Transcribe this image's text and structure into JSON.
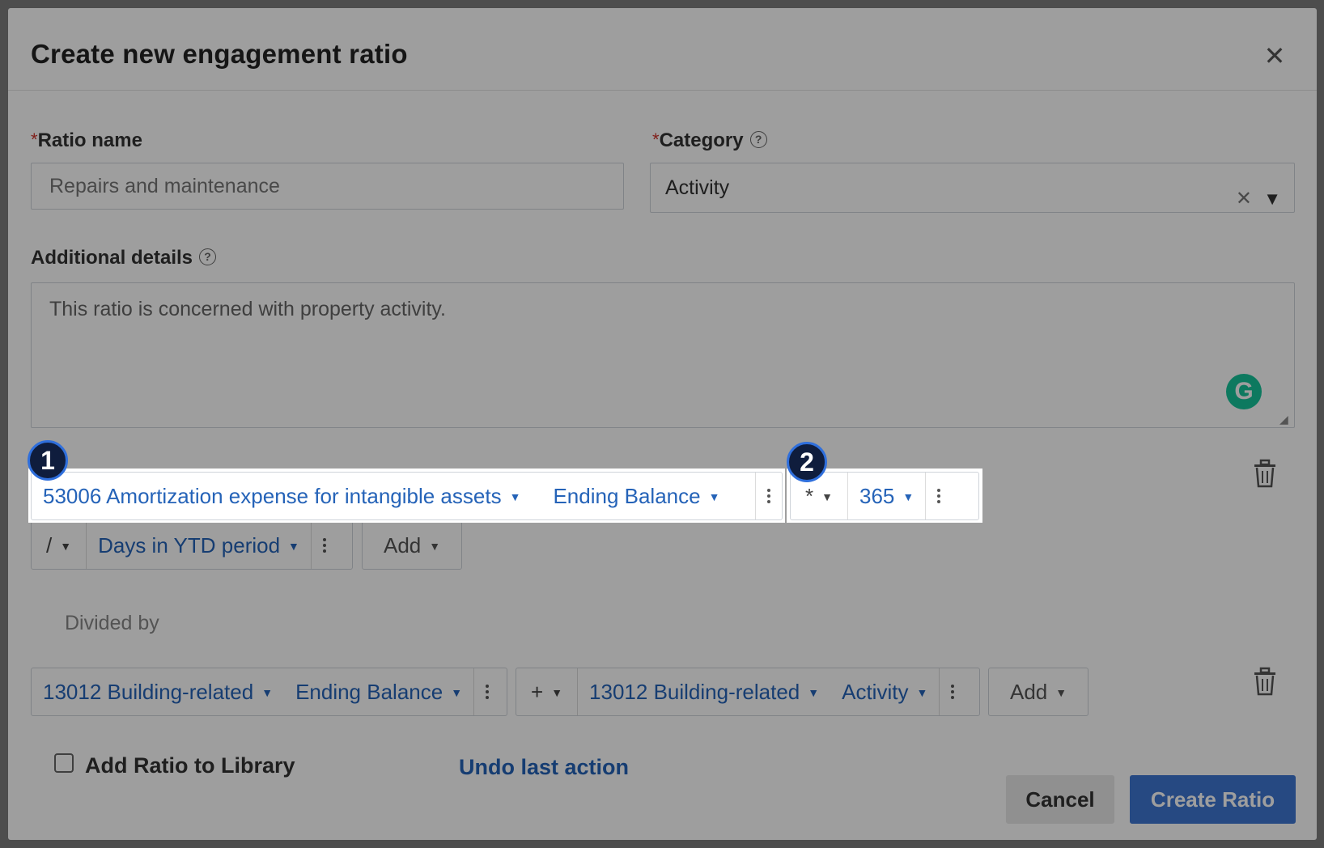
{
  "dialog": {
    "title": "Create new engagement ratio"
  },
  "ratio_name": {
    "label": "Ratio name",
    "required_mark": "*",
    "value": "Repairs and maintenance"
  },
  "category": {
    "label": "Category",
    "required_mark": "*",
    "value": "Activity",
    "clear_glyph": "✕"
  },
  "additional_details": {
    "label": "Additional details",
    "value": "This ratio is concerned with property activity."
  },
  "numerator": {
    "row1_group1": {
      "account": "53006 Amortization expense for intangible assets",
      "measure": "Ending Balance"
    },
    "row1_group2": {
      "operator": "*",
      "value": "365"
    },
    "row2": {
      "operator": "/",
      "value": "Days in YTD period",
      "add": "Add"
    }
  },
  "divided_by_label": "Divided by",
  "denominator": {
    "group1": {
      "account": "13012 Building-related",
      "measure": "Ending Balance"
    },
    "group2": {
      "operator": "+",
      "account": "13012 Building-related",
      "measure": "Activity"
    },
    "add": "Add"
  },
  "footer": {
    "add_to_library": "Add Ratio to Library",
    "undo": "Undo last action",
    "cancel": "Cancel",
    "create": "Create Ratio"
  },
  "callouts": [
    "1",
    "2"
  ],
  "colors": {
    "link": "#2563b8",
    "primary": "#3e76d2",
    "badge": "#0f1d3d"
  }
}
